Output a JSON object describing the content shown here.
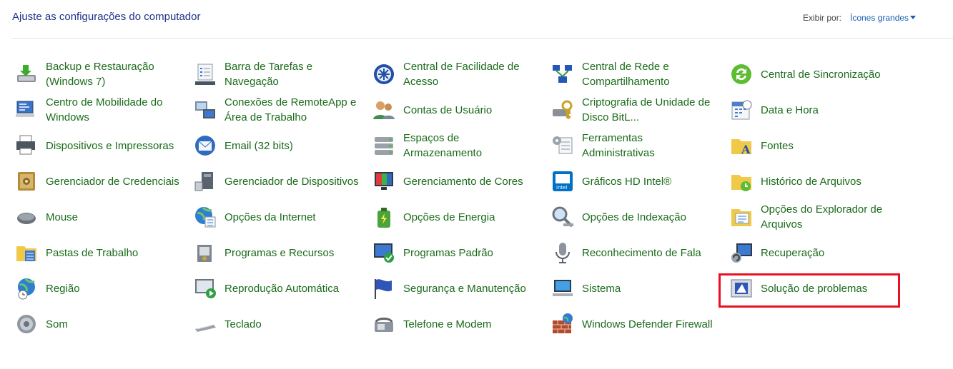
{
  "header": {
    "title": "Ajuste as configurações do computador",
    "view_by_label": "Exibir por:",
    "view_by_value": "Ícones grandes"
  },
  "items": [
    {
      "label": "Backup e Restauração (Windows 7)",
      "icon": "backup-restore-icon"
    },
    {
      "label": "Barra de Tarefas e Navegação",
      "icon": "taskbar-icon"
    },
    {
      "label": "Central de Facilidade de Acesso",
      "icon": "ease-of-access-icon"
    },
    {
      "label": "Central de Rede e Compartilhamento",
      "icon": "network-icon"
    },
    {
      "label": "Central de Sincronização",
      "icon": "sync-icon"
    },
    {
      "label": "Centro de Mobilidade do Windows",
      "icon": "mobility-icon"
    },
    {
      "label": "Conexões de RemoteApp e Área de Trabalho",
      "icon": "remoteapp-icon"
    },
    {
      "label": "Contas de Usuário",
      "icon": "user-accounts-icon"
    },
    {
      "label": "Criptografia de Unidade de Disco BitL...",
      "icon": "bitlocker-icon"
    },
    {
      "label": "Data e Hora",
      "icon": "calendar-clock-icon"
    },
    {
      "label": "Dispositivos e Impressoras",
      "icon": "printer-icon"
    },
    {
      "label": "Email (32 bits)",
      "icon": "mail-icon"
    },
    {
      "label": "Espaços de Armazenamento",
      "icon": "storage-spaces-icon"
    },
    {
      "label": "Ferramentas Administrativas",
      "icon": "admin-tools-icon"
    },
    {
      "label": "Fontes",
      "icon": "fonts-folder-icon"
    },
    {
      "label": "Gerenciador de Credenciais",
      "icon": "credential-vault-icon"
    },
    {
      "label": "Gerenciador de Dispositivos",
      "icon": "device-manager-icon"
    },
    {
      "label": "Gerenciamento de Cores",
      "icon": "color-management-icon"
    },
    {
      "label": "Gráficos HD Intel®",
      "icon": "intel-graphics-icon"
    },
    {
      "label": "Histórico de Arquivos",
      "icon": "file-history-icon"
    },
    {
      "label": "Mouse",
      "icon": "mouse-icon"
    },
    {
      "label": "Opções da Internet",
      "icon": "internet-options-icon"
    },
    {
      "label": "Opções de Energia",
      "icon": "power-options-icon"
    },
    {
      "label": "Opções de Indexação",
      "icon": "indexing-icon"
    },
    {
      "label": "Opções do Explorador de Arquivos",
      "icon": "folder-options-icon"
    },
    {
      "label": "Pastas de Trabalho",
      "icon": "work-folders-icon"
    },
    {
      "label": "Programas e Recursos",
      "icon": "programs-features-icon"
    },
    {
      "label": "Programas Padrão",
      "icon": "default-programs-icon"
    },
    {
      "label": "Reconhecimento de Fala",
      "icon": "microphone-icon"
    },
    {
      "label": "Recuperação",
      "icon": "recovery-icon"
    },
    {
      "label": "Região",
      "icon": "globe-clock-icon"
    },
    {
      "label": "Reprodução Automática",
      "icon": "autoplay-icon"
    },
    {
      "label": "Segurança e Manutenção",
      "icon": "flag-icon"
    },
    {
      "label": "Sistema",
      "icon": "computer-icon"
    },
    {
      "label": "Solução de problemas",
      "icon": "troubleshooting-icon"
    },
    {
      "label": "Som",
      "icon": "speaker-icon"
    },
    {
      "label": "Teclado",
      "icon": "keyboard-icon"
    },
    {
      "label": "Telefone e Modem",
      "icon": "phone-modem-icon"
    },
    {
      "label": "Windows Defender Firewall",
      "icon": "firewall-icon"
    }
  ],
  "colors": {
    "link_green": "#1b6b1b",
    "title_blue": "#1e3287",
    "highlight_red": "#e81123"
  }
}
